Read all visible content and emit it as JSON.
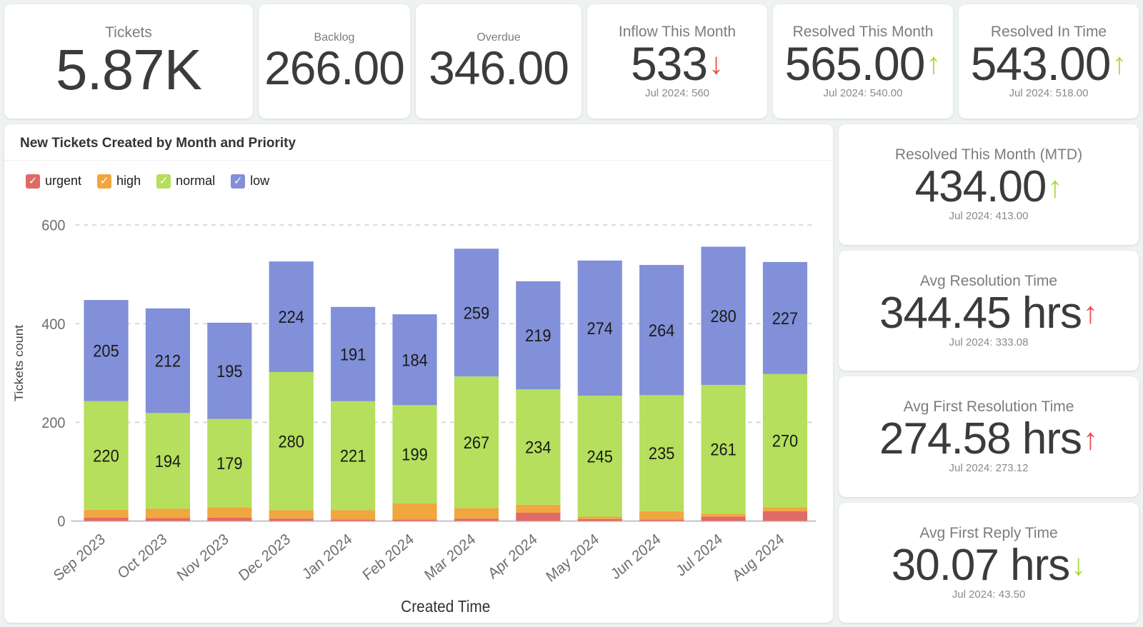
{
  "top_kpis": [
    {
      "title": "Tickets",
      "value": "5.87K",
      "arrow": "",
      "arrow_color": "",
      "prev": ""
    },
    {
      "title": "Backlog",
      "value": "266.00",
      "arrow": "",
      "arrow_color": "",
      "prev": ""
    },
    {
      "title": "Overdue",
      "value": "346.00",
      "arrow": "",
      "arrow_color": "",
      "prev": ""
    },
    {
      "title": "Inflow This Month",
      "value": "533",
      "arrow": "down",
      "arrow_color": "#ef4b4b",
      "prev": "Jul 2024: 560"
    },
    {
      "title": "Resolved This Month",
      "value": "565.00",
      "arrow": "up",
      "arrow_color": "#a8d943",
      "prev": "Jul 2024: 540.00"
    },
    {
      "title": "Resolved In Time",
      "value": "543.00",
      "arrow": "up",
      "arrow_color": "#a8d943",
      "prev": "Jul 2024: 518.00"
    }
  ],
  "side_kpis": [
    {
      "title": "Resolved This Month (MTD)",
      "value": "434.00",
      "arrow": "up",
      "arrow_color": "#a8d943",
      "prev": "Jul 2024: 413.00"
    },
    {
      "title": "Avg Resolution Time",
      "value": "344.45 hrs",
      "arrow": "up",
      "arrow_color": "#ef4b4b",
      "prev": "Jul 2024: 333.08"
    },
    {
      "title": "Avg First Resolution Time",
      "value": "274.58 hrs",
      "arrow": "up",
      "arrow_color": "#ef4b4b",
      "prev": "Jul 2024: 273.12"
    },
    {
      "title": "Avg First Reply Time",
      "value": "30.07 hrs",
      "arrow": "down",
      "arrow_color": "#a8d943",
      "prev": "Jul 2024: 43.50"
    }
  ],
  "chart_card": {
    "title": "New Tickets Created by Month and Priority",
    "legend": [
      {
        "label": "urgent",
        "color": "#e06a65",
        "checked": true,
        "check": "✓"
      },
      {
        "label": "high",
        "color": "#f0a73f",
        "checked": true,
        "check": "✓"
      },
      {
        "label": "normal",
        "color": "#b5df5c",
        "checked": true,
        "check": "✓"
      },
      {
        "label": "low",
        "color": "#8190d8",
        "checked": true,
        "check": "✓"
      }
    ]
  },
  "chart_data": {
    "type": "bar",
    "stacked": true,
    "title": "New Tickets Created by Month and Priority",
    "xlabel": "Created Time",
    "ylabel": "Tickets count",
    "ylim": [
      0,
      640
    ],
    "yticks": [
      0,
      200,
      400,
      600
    ],
    "grid": true,
    "legend_position": "top-left",
    "label_threshold": 40,
    "categories": [
      "Sep 2023",
      "Oct 2023",
      "Nov 2023",
      "Dec 2023",
      "Jan 2024",
      "Feb 2024",
      "Mar 2024",
      "Apr 2024",
      "May 2024",
      "Jun 2024",
      "Jul 2024",
      "Aug 2024"
    ],
    "series": [
      {
        "name": "urgent",
        "color": "#e06a65",
        "values": [
          7,
          6,
          7,
          5,
          3,
          3,
          5,
          17,
          4,
          3,
          9,
          20
        ]
      },
      {
        "name": "high",
        "color": "#f0a73f",
        "values": [
          16,
          19,
          21,
          17,
          19,
          33,
          21,
          16,
          5,
          17,
          6,
          8
        ]
      },
      {
        "name": "normal",
        "color": "#b5df5c",
        "values": [
          220,
          194,
          179,
          280,
          221,
          199,
          267,
          234,
          245,
          235,
          261,
          270
        ]
      },
      {
        "name": "low",
        "color": "#8190d8",
        "values": [
          205,
          212,
          195,
          224,
          191,
          184,
          259,
          219,
          274,
          264,
          280,
          227
        ]
      }
    ],
    "totals": [
      448,
      431,
      402,
      526,
      434,
      419,
      552,
      486,
      528,
      519,
      556,
      525
    ]
  }
}
